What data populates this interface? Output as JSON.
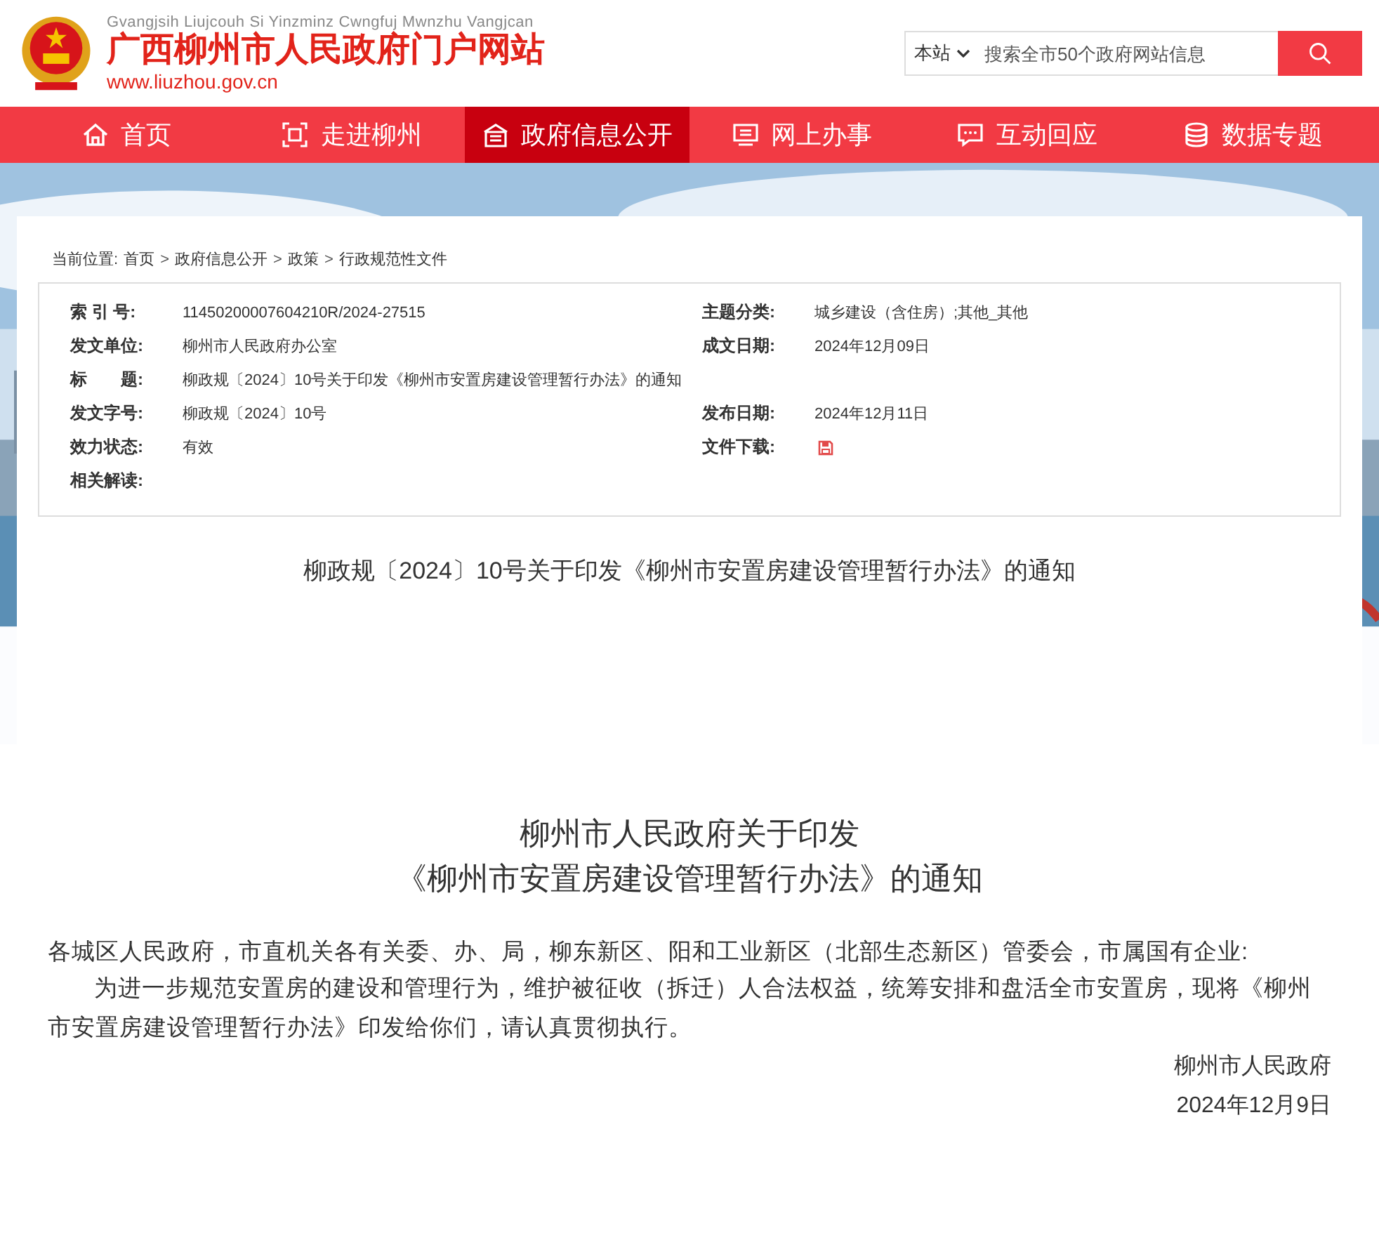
{
  "header": {
    "pinyin": "Gvangjsih Liujcouh Si Yinzminz Cwngfuj Mwnzhu Vangjcan",
    "site_name": "广西柳州市人民政府门户网站",
    "url": "www.liuzhou.gov.cn",
    "search": {
      "scope": "本站",
      "placeholder": "搜索全市50个政府网站信息"
    }
  },
  "nav": [
    {
      "label": "首页",
      "selected": false
    },
    {
      "label": "走进柳州",
      "selected": false
    },
    {
      "label": "政府信息公开",
      "selected": true
    },
    {
      "label": "网上办事",
      "selected": false
    },
    {
      "label": "互动回应",
      "selected": false
    },
    {
      "label": "数据专题",
      "selected": false
    }
  ],
  "breadcrumb": {
    "prefix": "当前位置:",
    "separator": ">",
    "items": [
      "首页",
      "政府信息公开",
      "政策",
      "行政规范性文件"
    ]
  },
  "meta": [
    {
      "label": "索 引 号:",
      "value": "11450200007604210R/2024-27515",
      "kind": "text"
    },
    {
      "label": "主题分类:",
      "value": "城乡建设（含住房）;其他_其他",
      "kind": "text"
    },
    {
      "label": "发文单位:",
      "value": "柳州市人民政府办公室",
      "kind": "text"
    },
    {
      "label": "成文日期:",
      "value": "2024年12月09日",
      "kind": "text"
    },
    {
      "label": "标　　题:",
      "value": "柳政规〔2024〕10号关于印发《柳州市安置房建设管理暂行办法》的通知",
      "kind": "wide"
    },
    {
      "label": "发文字号:",
      "value": "柳政规〔2024〕10号",
      "kind": "text"
    },
    {
      "label": "发布日期:",
      "value": "2024年12月11日",
      "kind": "text"
    },
    {
      "label": "效力状态:",
      "value": "有效",
      "kind": "text"
    },
    {
      "label": "文件下载:",
      "kind": "download"
    },
    {
      "label": "相关解读:",
      "kind": "empty"
    }
  ],
  "doc_title": "柳政规〔2024〕10号关于印发《柳州市安置房建设管理暂行办法》的通知",
  "article": {
    "heading": [
      "柳州市人民政府关于印发",
      "《柳州市安置房建设管理暂行办法》的通知"
    ],
    "salutation": "各城区人民政府，市直机关各有关委、办、局，柳东新区、阳和工业新区（北部生态新区）管委会，市属国有企业:",
    "paragraphs": [
      "为进一步规范安置房的建设和管理行为，维护被征收（拆迁）人合法权益，统筹安排和盘活全市安置房，现将《柳州市安置房建设管理暂行办法》印发给你们，请认真贯彻执行。"
    ],
    "signature": "柳州市人民政府",
    "date": "2024年12月9日"
  }
}
